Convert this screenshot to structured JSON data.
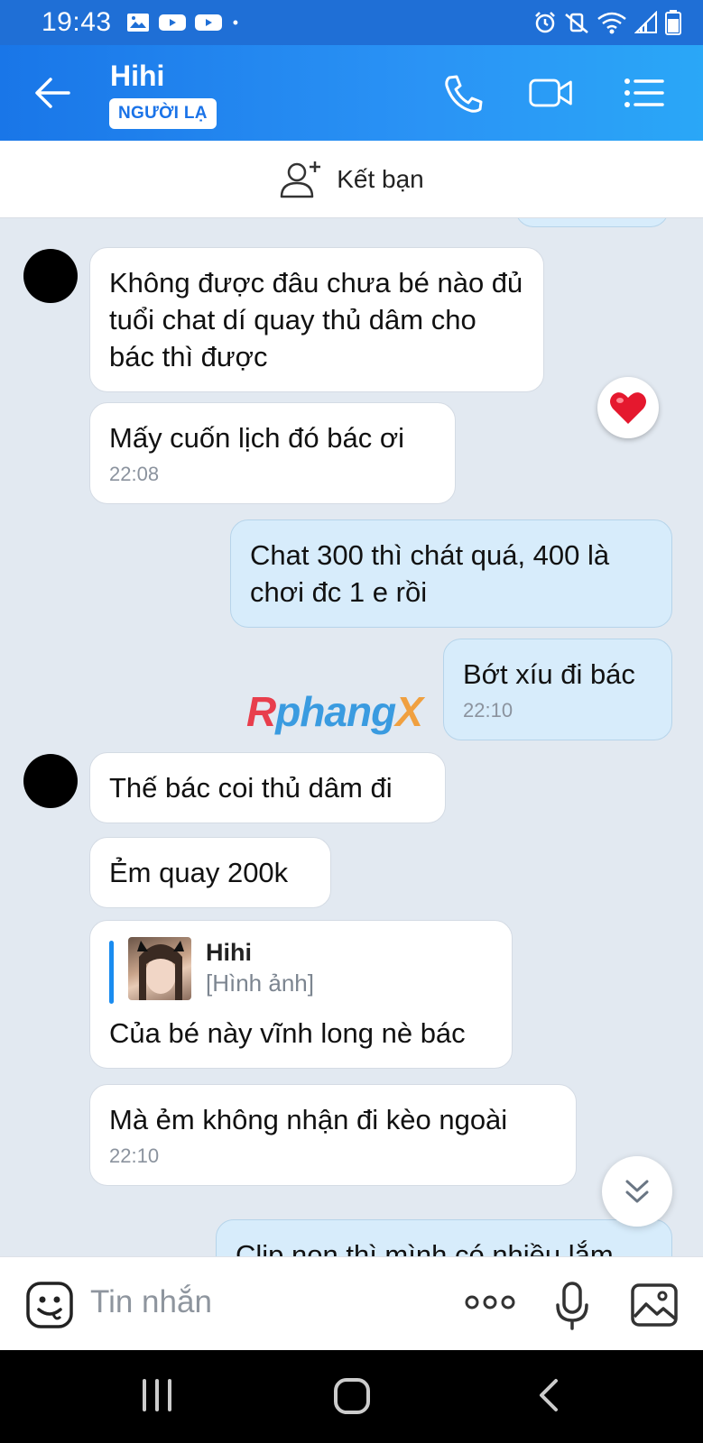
{
  "status_bar": {
    "time": "19:43"
  },
  "header": {
    "title": "Hihi",
    "badge": "NGƯỜI LẠ"
  },
  "friend_bar": {
    "label": "Kết bạn"
  },
  "messages": {
    "m1": "Không được đâu chưa bé nào đủ tuổi chat dí quay thủ dâm cho bác thì được",
    "m2": "Mấy cuốn lịch đó bác ơi",
    "m2_time": "22:08",
    "m3": "Chat 300 thì chát quá, 400 là chơi đc 1 e rồi",
    "m4": "Bớt xíu đi bác",
    "m4_time": "22:10",
    "m5": "Thế bác coi thủ dâm đi",
    "m6": "Ẻm quay 200k",
    "m7_reply_name": "Hihi",
    "m7_reply_sub": "[Hình ảnh]",
    "m7": "Của bé này vĩnh long nè bác",
    "m8": "Mà ẻm không nhận đi kèo ngoài",
    "m8_time": "22:10",
    "m9_partial": "Clip non thì mình có nhiều lắm"
  },
  "watermark": {
    "r": "R",
    "mid": "phang",
    "x": "X"
  },
  "composer": {
    "placeholder": "Tin nhắn"
  },
  "colors": {
    "header": "#1f7ae8",
    "outgoing_bubble": "#d7ecfb",
    "chat_bg": "#e2e9f1",
    "badge_text": "#1a73e8"
  }
}
